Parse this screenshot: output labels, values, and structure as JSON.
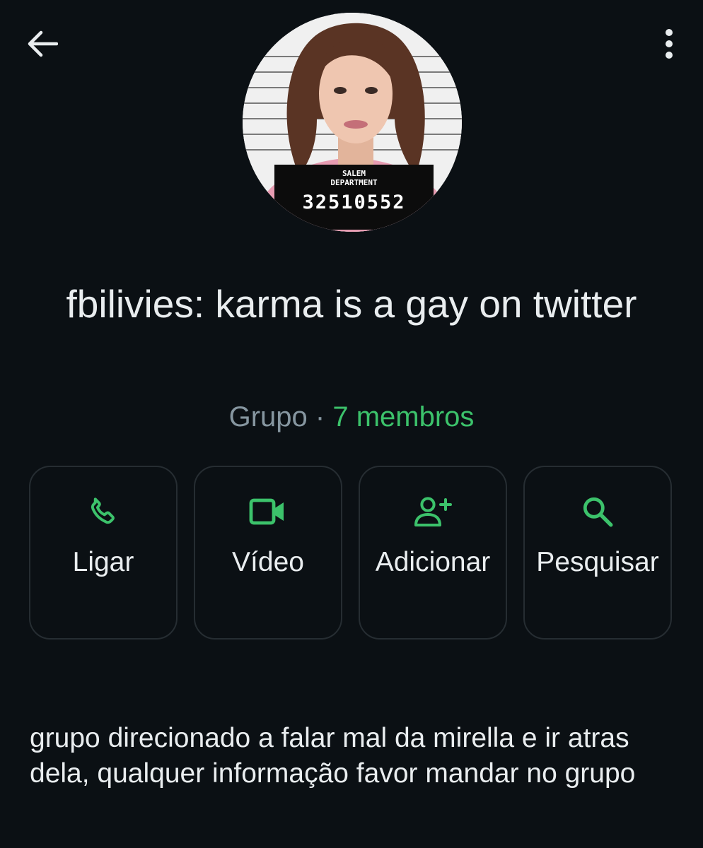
{
  "group": {
    "name": "fbilivies: karma is a gay on twitter",
    "type": "Grupo",
    "separator": "·",
    "members": "7 membros",
    "avatar": {
      "badge_line1": "SALEM",
      "badge_line2": "DEPARTMENT",
      "badge_number": "32510552"
    }
  },
  "actions": [
    {
      "label": "Ligar",
      "icon": "phone-icon"
    },
    {
      "label": "Vídeo",
      "icon": "video-icon"
    },
    {
      "label": "Adicionar",
      "icon": "add-person-icon"
    },
    {
      "label": "Pesquisar",
      "icon": "search-icon"
    }
  ],
  "description": "grupo direcionado a falar mal da mirella e ir atras dela, qualquer informação favor mandar no grupo",
  "colors": {
    "background": "#0b1014",
    "accent": "#3cc26b",
    "muted": "#8696a0",
    "card_border": "#262d32"
  }
}
